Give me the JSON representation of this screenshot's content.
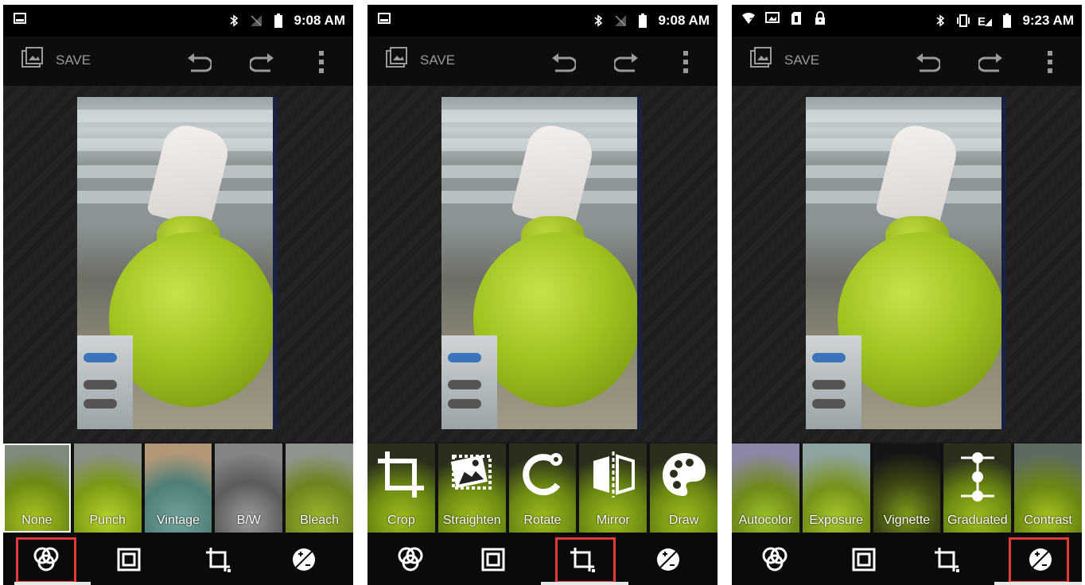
{
  "screens": [
    {
      "status": {
        "time": "9:08 AM"
      },
      "toolbar": {
        "save_label": "SAVE"
      },
      "thumbnails": [
        "None",
        "Punch",
        "Vintage",
        "B/W",
        "Bleach"
      ],
      "selected_thumbnail": "None",
      "active_tool": "filters"
    },
    {
      "status": {
        "time": "9:08 AM"
      },
      "toolbar": {
        "save_label": "SAVE"
      },
      "thumbnails": [
        "Crop",
        "Straighten",
        "Rotate",
        "Mirror",
        "Draw"
      ],
      "active_tool": "geometry"
    },
    {
      "status": {
        "time": "9:23 AM"
      },
      "toolbar": {
        "save_label": "SAVE"
      },
      "thumbnails": [
        "Autocolor",
        "Exposure",
        "Vignette",
        "Graduated",
        "Contrast"
      ],
      "active_tool": "adjust"
    }
  ],
  "colors": {
    "highlight": "#e53935",
    "toolbar_text": "#9a9a9a"
  }
}
